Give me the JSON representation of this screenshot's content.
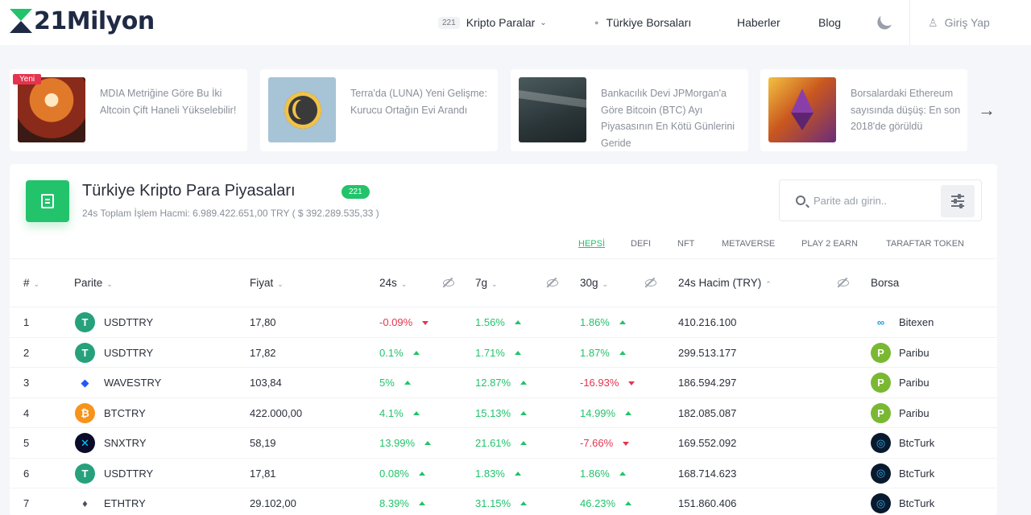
{
  "brand": {
    "name": "21Milyon"
  },
  "nav": {
    "crypto_badge": "221",
    "crypto_label": "Kripto Paralar",
    "exchanges_label": "Türkiye Borsaları",
    "news_label": "Haberler",
    "blog_label": "Blog",
    "login_label": "Giriş Yap"
  },
  "news": {
    "new_badge": "Yeni",
    "items": [
      {
        "text": "MDIA Metriğine Göre Bu İki Altcoin Çift Haneli Yükselebilir!"
      },
      {
        "text": "Terra'da (LUNA) Yeni Gelişme: Kurucu Ortağın Evi Arandı"
      },
      {
        "text": "Bankacılık Devi JPMorgan'a Göre Bitcoin (BTC) Ayı Piyasasının En Kötü Günlerini Geride"
      },
      {
        "text": "Borsalardaki Ethereum sayısında düşüş: En son 2018'de görüldü"
      }
    ]
  },
  "market": {
    "title": "Türkiye Kripto Para Piyasaları",
    "count_badge": "221",
    "volume_text": "24s Toplam İşlem Hacmi: 6.989.422.651,00 TRY ( $ 392.289.535,33 )",
    "search_placeholder": "Parite adı girin..",
    "categories": [
      "HEPSİ",
      "DEFI",
      "NFT",
      "METAVERSE",
      "PLAY 2 EARN",
      "TARAFTAR TOKEN"
    ],
    "columns": {
      "rank": "#",
      "pair": "Parite",
      "price": "Fiyat",
      "d1": "24s",
      "d7": "7g",
      "d30": "30g",
      "volume": "24s Hacim (TRY)",
      "exchange": "Borsa"
    },
    "rows": [
      {
        "rank": "1",
        "pair": "USDTTRY",
        "coin": "tether-icon",
        "price": "17,80",
        "d1": "-0.09%",
        "d1_dir": "down",
        "d7": "1.56%",
        "d7_dir": "up",
        "d30": "1.86%",
        "d30_dir": "up",
        "volume": "410.216.100",
        "exchange": "Bitexen",
        "ex_icon": "bitexen-icon"
      },
      {
        "rank": "2",
        "pair": "USDTTRY",
        "coin": "tether-icon",
        "price": "17,82",
        "d1": "0.1%",
        "d1_dir": "up",
        "d7": "1.71%",
        "d7_dir": "up",
        "d30": "1.87%",
        "d30_dir": "up",
        "volume": "299.513.177",
        "exchange": "Paribu",
        "ex_icon": "paribu-icon"
      },
      {
        "rank": "3",
        "pair": "WAVESTRY",
        "coin": "waves-icon",
        "price": "103,84",
        "d1": "5%",
        "d1_dir": "up",
        "d7": "12.87%",
        "d7_dir": "up",
        "d30": "-16.93%",
        "d30_dir": "down",
        "volume": "186.594.297",
        "exchange": "Paribu",
        "ex_icon": "paribu-icon"
      },
      {
        "rank": "4",
        "pair": "BTCTRY",
        "coin": "bitcoin-icon",
        "price": "422.000,00",
        "d1": "4.1%",
        "d1_dir": "up",
        "d7": "15.13%",
        "d7_dir": "up",
        "d30": "14.99%",
        "d30_dir": "up",
        "volume": "182.085.087",
        "exchange": "Paribu",
        "ex_icon": "paribu-icon"
      },
      {
        "rank": "5",
        "pair": "SNXTRY",
        "coin": "synthetix-icon",
        "price": "58,19",
        "d1": "13.99%",
        "d1_dir": "up",
        "d7": "21.61%",
        "d7_dir": "up",
        "d30": "-7.66%",
        "d30_dir": "down",
        "volume": "169.552.092",
        "exchange": "BtcTurk",
        "ex_icon": "btcturk-icon"
      },
      {
        "rank": "6",
        "pair": "USDTTRY",
        "coin": "tether-icon",
        "price": "17,81",
        "d1": "0.08%",
        "d1_dir": "up",
        "d7": "1.83%",
        "d7_dir": "up",
        "d30": "1.86%",
        "d30_dir": "up",
        "volume": "168.714.623",
        "exchange": "BtcTurk",
        "ex_icon": "btcturk-icon"
      },
      {
        "rank": "7",
        "pair": "ETHTRY",
        "coin": "ethereum-icon",
        "price": "29.102,00",
        "d1": "8.39%",
        "d1_dir": "up",
        "d7": "31.15%",
        "d7_dir": "up",
        "d30": "46.23%",
        "d30_dir": "up",
        "volume": "151.860.406",
        "exchange": "BtcTurk",
        "ex_icon": "btcturk-icon"
      }
    ]
  },
  "colors": {
    "accent": "#22c36b",
    "negative": "#e5344e",
    "text": "#2a2f3a"
  }
}
